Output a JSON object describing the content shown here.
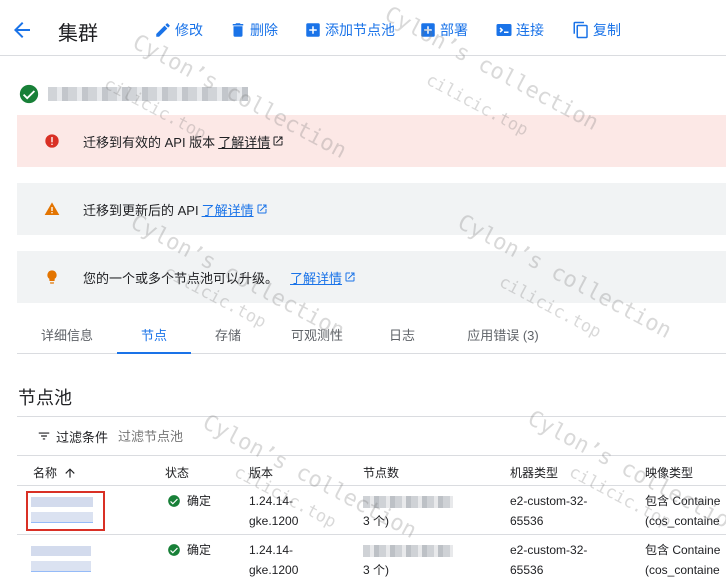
{
  "header": {
    "title": "集群",
    "actions": [
      {
        "label": "修改",
        "icon": "pencil-icon"
      },
      {
        "label": "删除",
        "icon": "trash-icon"
      },
      {
        "label": "添加节点池",
        "icon": "add-box-icon"
      },
      {
        "label": "部署",
        "icon": "add-box-icon"
      },
      {
        "label": "连接",
        "icon": "terminal-icon"
      },
      {
        "label": "复制",
        "icon": "copy-icon"
      }
    ]
  },
  "banners": [
    {
      "type": "error",
      "text": "迁移到有效的 API 版本",
      "link": "了解详情"
    },
    {
      "type": "warning",
      "text": "迁移到更新后的 API",
      "link": "了解详情"
    },
    {
      "type": "info",
      "text": "您的一个或多个节点池可以升级。",
      "link": "了解详情"
    }
  ],
  "tabs": [
    "详细信息",
    "节点",
    "存储",
    "可观测性",
    "日志",
    "应用错误 (3)"
  ],
  "active_tab": 1,
  "node_pools": {
    "title": "节点池",
    "filter_label": "过滤条件",
    "filter_placeholder": "过滤节点池",
    "columns": [
      "名称",
      "状态",
      "版本",
      "节点数",
      "机器类型",
      "映像类型"
    ],
    "rows": [
      {
        "status": "确定",
        "version_line1": "1.24.14-",
        "version_line2": "gke.1200",
        "nodes_line2": "3 个)",
        "machine_line1": "e2-custom-32-",
        "machine_line2": "65536",
        "image_line1": "包含 Containe",
        "image_line2": "(cos_containe"
      },
      {
        "status": "确定",
        "version_line1": "1.24.14-",
        "version_line2": "gke.1200",
        "nodes_line2": "3 个)",
        "machine_line1": "e2-custom-32-",
        "machine_line2": "65536",
        "image_line1": "包含 Containe",
        "image_line2": "(cos_containe"
      }
    ]
  },
  "watermarks": [
    "Cylon’s collection",
    "cilicic.top"
  ],
  "colors": {
    "accent": "#1a73e8",
    "error": "#d93025",
    "warning": "#e37400",
    "success": "#188038"
  }
}
